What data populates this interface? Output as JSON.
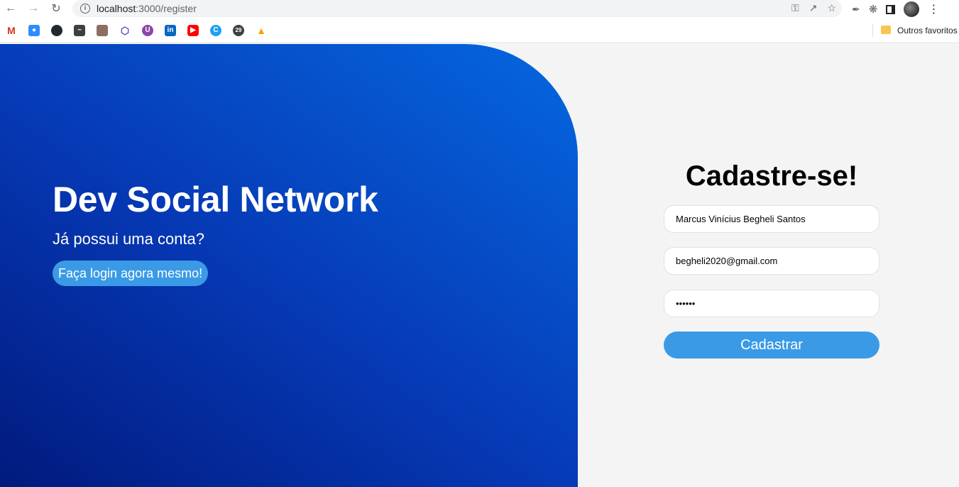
{
  "browser": {
    "url_host": "localhost",
    "url_path": ":3000/register",
    "bookmarks_other": "Outros favoritos",
    "bookmark_icons": [
      "gmail-icon",
      "zoom-icon",
      "github-icon",
      "image-icon",
      "photo-icon",
      "hexagon-icon",
      "u-icon",
      "linkedin-icon",
      "youtube-icon",
      "c-icon",
      "calendar-29-icon",
      "firebase-icon"
    ],
    "calendar_badge": "29"
  },
  "hero": {
    "title": "Dev Social Network",
    "subtitle": "Já possui uma conta?",
    "login_button": "Faça login agora mesmo!"
  },
  "form": {
    "title": "Cadastre-se!",
    "name_value": "Marcus Vinícius Begheli Santos",
    "email_value": "begheli2020@gmail.com",
    "password_value": "••••••",
    "submit_label": "Cadastrar"
  },
  "colors": {
    "accent": "#3a9ae6",
    "hero_dark": "#011a7e",
    "hero_light": "#0568e0",
    "page_bg": "#f4f4f4"
  }
}
